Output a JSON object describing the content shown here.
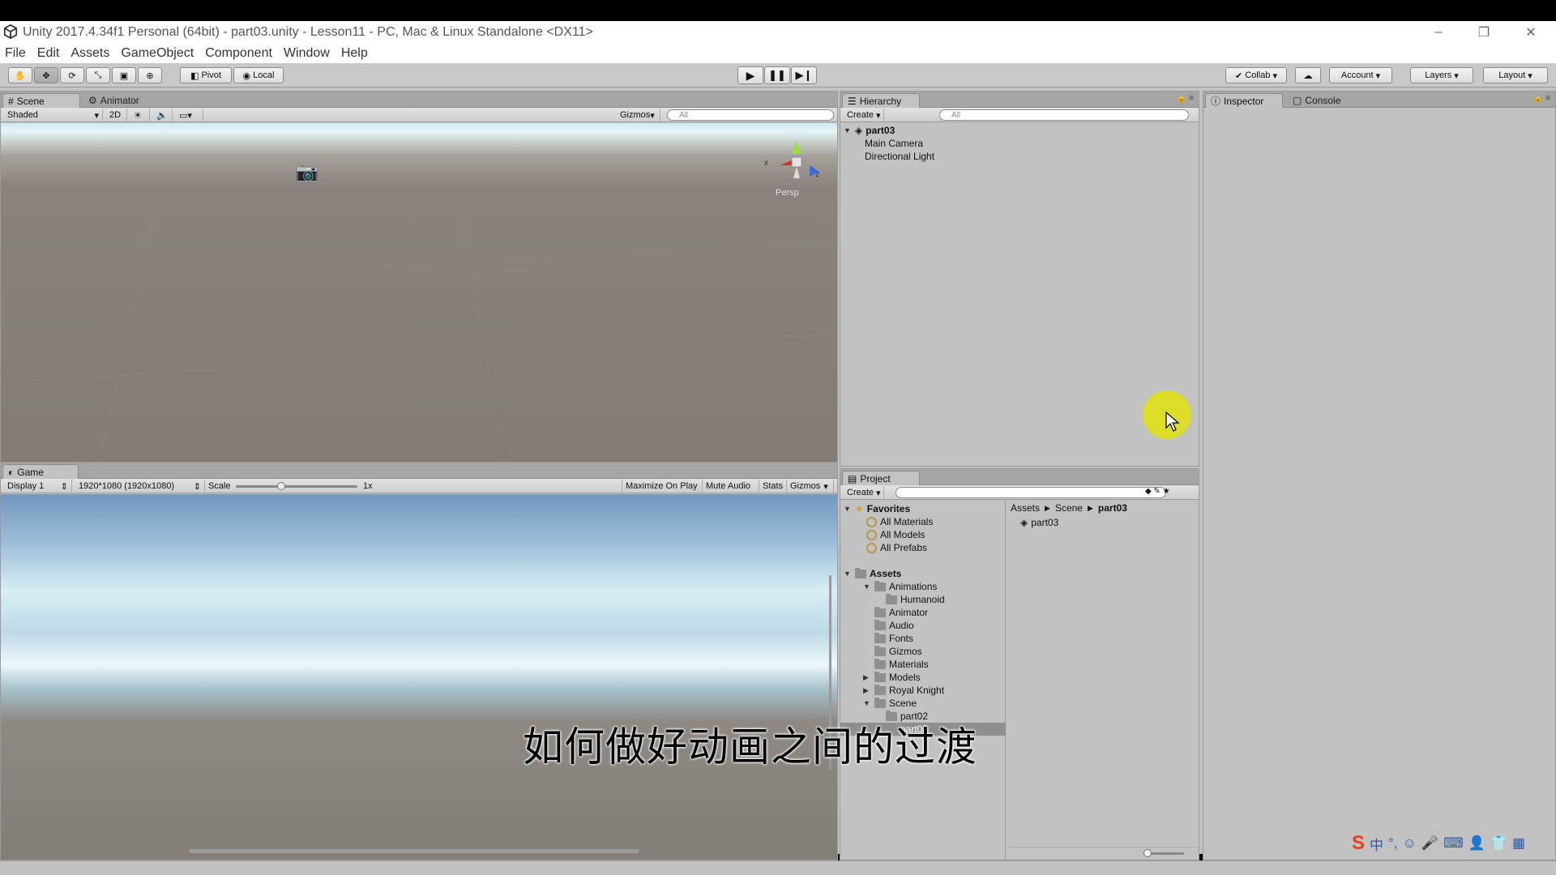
{
  "window": {
    "title": "Unity 2017.4.34f1 Personal (64bit) - part03.unity - Lesson11 - PC, Mac & Linux Standalone <DX11>",
    "controls": [
      "–",
      "❐",
      "✕"
    ]
  },
  "menu": [
    "File",
    "Edit",
    "Assets",
    "GameObject",
    "Component",
    "Window",
    "Help"
  ],
  "toolbar": {
    "pivot": "Pivot",
    "local": "Local",
    "collab": "Collab",
    "account": "Account",
    "layers": "Layers",
    "layout": "Layout"
  },
  "scene_panel": {
    "tabs": [
      "Scene",
      "Animator"
    ],
    "shading": "Shaded",
    "mode_2d": "2D",
    "gizmos": "Gizmos",
    "search_placeholder": "All",
    "persp": "Persp",
    "axis_x": "x",
    "axis_z": "z"
  },
  "game_panel": {
    "tab": "Game",
    "display": "Display 1",
    "resolution": "1920*1080 (1920x1080)",
    "scale_label": "Scale",
    "scale_value": "1x",
    "buttons": [
      "Maximize On Play",
      "Mute Audio",
      "Stats",
      "Gizmos"
    ]
  },
  "hierarchy": {
    "tab": "Hierarchy",
    "create": "Create",
    "search_placeholder": "All",
    "scene": "part03",
    "items": [
      "Main Camera",
      "Directional Light"
    ]
  },
  "inspector": {
    "tabs": [
      "Inspector",
      "Console"
    ]
  },
  "project": {
    "tab": "Project",
    "create": "Create",
    "favorites_label": "Favorites",
    "favorites": [
      "All Materials",
      "All Models",
      "All Prefabs"
    ],
    "assets_label": "Assets",
    "tree": [
      {
        "label": "Animations",
        "depth": 1,
        "arrow": "▼"
      },
      {
        "label": "Humanoid",
        "depth": 2,
        "arrow": ""
      },
      {
        "label": "Animator",
        "depth": 1,
        "arrow": ""
      },
      {
        "label": "Audio",
        "depth": 1,
        "arrow": ""
      },
      {
        "label": "Fonts",
        "depth": 1,
        "arrow": ""
      },
      {
        "label": "Gizmos",
        "depth": 1,
        "arrow": ""
      },
      {
        "label": "Materials",
        "depth": 1,
        "arrow": ""
      },
      {
        "label": "Models",
        "depth": 1,
        "arrow": "▶"
      },
      {
        "label": "Royal Knight",
        "depth": 1,
        "arrow": "▶"
      },
      {
        "label": "Scene",
        "depth": 1,
        "arrow": "▼"
      },
      {
        "label": "part02",
        "depth": 2,
        "arrow": ""
      },
      {
        "label": "part03",
        "depth": 2,
        "arrow": "",
        "selected": true
      }
    ],
    "breadcrumb": [
      "Assets",
      "Scene",
      "part03"
    ],
    "files": [
      "part03"
    ]
  },
  "subtitle": "如何做好动画之间的过渡",
  "colors": {
    "cursor_highlight": "#e4e200",
    "sogou": "#e8401c"
  }
}
